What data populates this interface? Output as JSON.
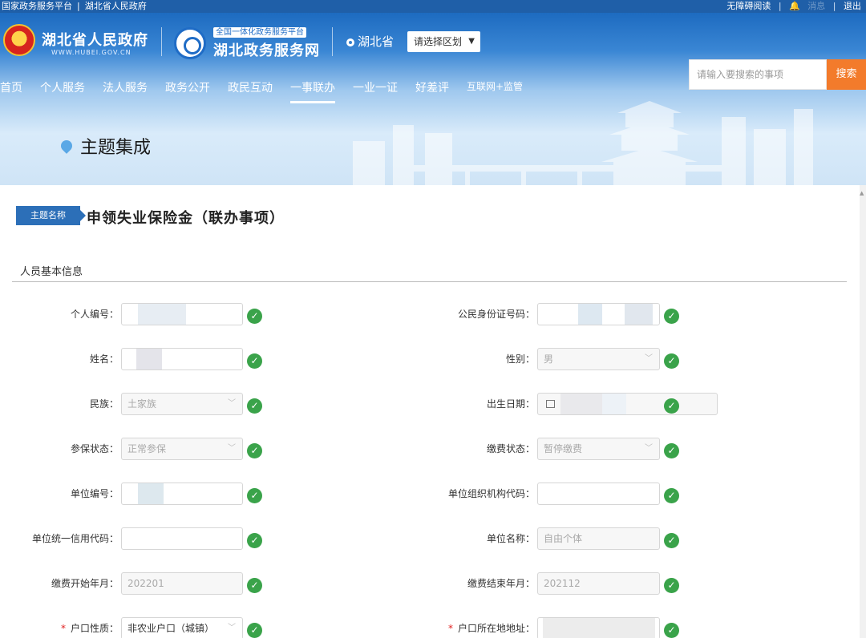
{
  "topbar": {
    "link1": "国家政务服务平台",
    "link2": "湖北省人民政府",
    "accessible": "无障碍阅读",
    "messages": "消息",
    "logout": "退出"
  },
  "header": {
    "gov_name": "湖北省人民政府",
    "gov_url": "WWW.HUBEI.GOV.CN",
    "platform_tag": "全国一体化政务服务平台",
    "service_name": "湖北政务服务网",
    "province": "湖北省",
    "region_select": "请选择区划"
  },
  "nav": [
    "首页",
    "个人服务",
    "法人服务",
    "政务公开",
    "政民互动",
    "一事联办",
    "一业一证",
    "好差评",
    "互联网+监管"
  ],
  "search": {
    "placeholder": "请输入要搜索的事项",
    "button": "搜索"
  },
  "page_title": "主题集成",
  "topic": {
    "tag": "主题名称",
    "name": "申领失业保险金（联办事项）"
  },
  "section_title": "人员基本信息",
  "form": {
    "personal_no": {
      "label": "个人编号："
    },
    "id_no": {
      "label": "公民身份证号码："
    },
    "name": {
      "label": "姓名："
    },
    "gender": {
      "label": "性别：",
      "value": "男"
    },
    "ethnicity": {
      "label": "民族：",
      "value": "土家族"
    },
    "birth_date": {
      "label": "出生日期："
    },
    "insured_status": {
      "label": "参保状态：",
      "value": "正常参保"
    },
    "payment_status": {
      "label": "缴费状态：",
      "value": "暂停缴费"
    },
    "unit_no": {
      "label": "单位编号："
    },
    "unit_org_code": {
      "label": "单位组织机构代码：",
      "value": ""
    },
    "unit_credit_code": {
      "label": "单位统一信用代码：",
      "value": ""
    },
    "unit_name": {
      "label": "单位名称：",
      "value": "自由个体"
    },
    "pay_start": {
      "label": "缴费开始年月：",
      "value": "202201"
    },
    "pay_end": {
      "label": "缴费结束年月：",
      "value": "202112"
    },
    "hukou_type": {
      "label": "户口性质：",
      "value": "非农业户口（城镇）"
    },
    "hukou_address": {
      "label": "户口所在地地址："
    },
    "required_mark": "*",
    "check_mark": "✓"
  }
}
